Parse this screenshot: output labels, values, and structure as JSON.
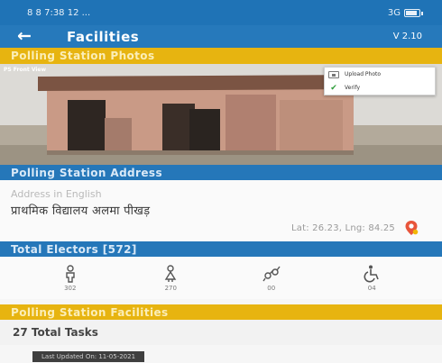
{
  "status_bar": {
    "left": "8 8 7:38 12 ...",
    "right": "3G"
  },
  "app_bar": {
    "title": "Facilities",
    "version": "V 2.10",
    "back_icon": "back-arrow-icon"
  },
  "photos_section": {
    "header": "Polling Station Photos",
    "photo_label": "PS Front View",
    "menu": {
      "upload_label": "Upload Photo",
      "verify_label": "Verify"
    }
  },
  "address_section": {
    "header": "Polling Station Address",
    "placeholder": "Address in English",
    "address_hindi": "प्राथमिक विद्यालय अलमा पीखड़",
    "latlng": "Lat: 26.23, Lng: 84.25",
    "pin_icon": "map-pin-icon",
    "pin_color": "#e8553b"
  },
  "electors_section": {
    "header": "Total Electors [572]",
    "stats": [
      {
        "icon": "male-icon",
        "value": "302"
      },
      {
        "icon": "female-icon",
        "value": "270"
      },
      {
        "icon": "third-gender-icon",
        "value": "00"
      },
      {
        "icon": "wheelchair-icon",
        "value": "04"
      }
    ]
  },
  "facilities_section": {
    "header": "Polling Station Facilities",
    "tasks": "27 Total Tasks",
    "last_updated": "Last Updated On: 11-05-2021"
  },
  "colors": {
    "primary": "#2679bb",
    "accent": "#e7b410"
  }
}
